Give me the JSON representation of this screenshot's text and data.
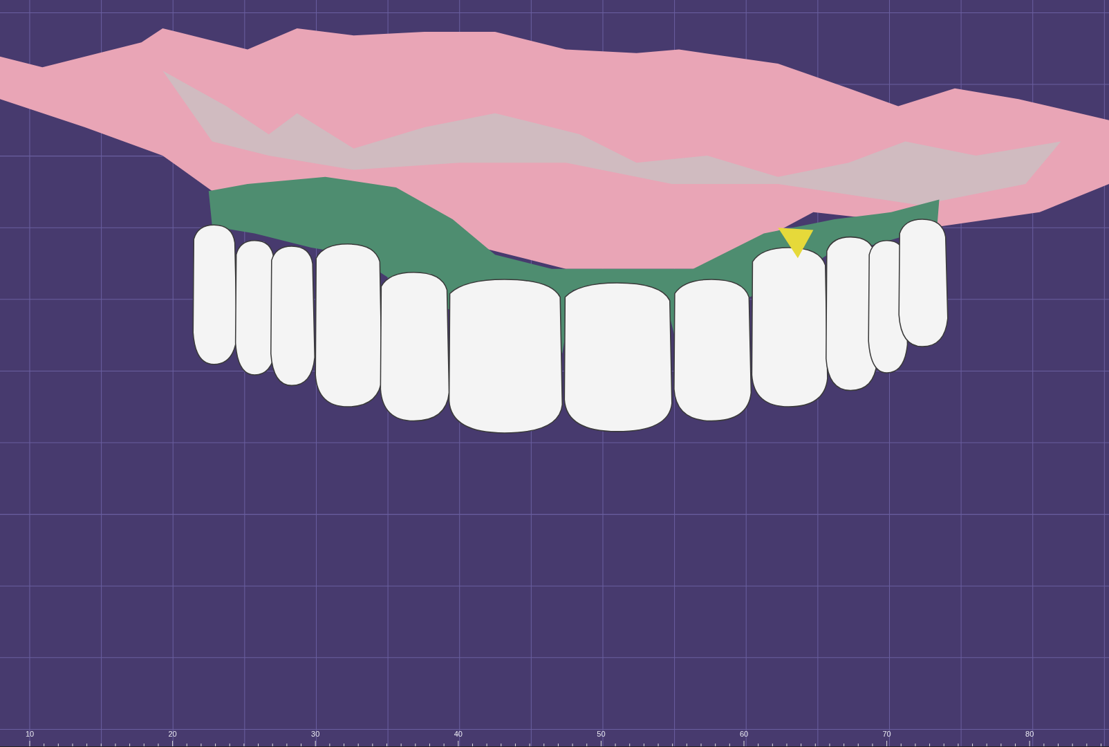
{
  "viewport": {
    "ruler": {
      "labels": [
        "10",
        "20",
        "30",
        "40",
        "50",
        "60",
        "70",
        "80"
      ]
    }
  }
}
